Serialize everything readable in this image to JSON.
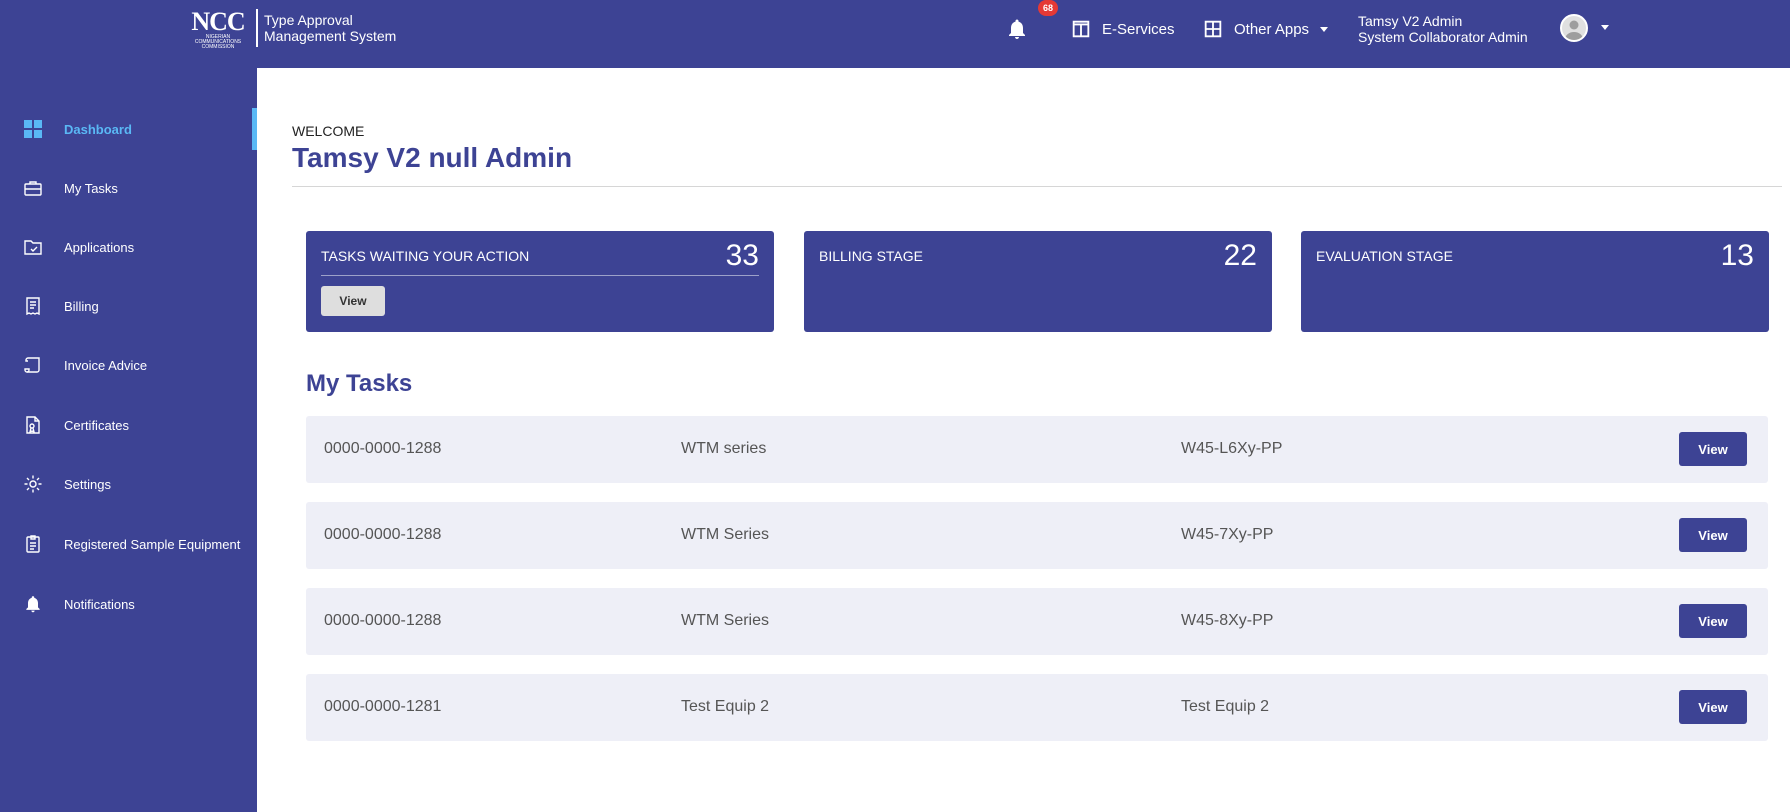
{
  "header": {
    "logo_text": "NCC",
    "logo_subtext": "NIGERIAN COMMUNICATIONS COMMISSION",
    "app_title_line1": "Type Approval",
    "app_title_line2": "Management System",
    "notification_count": "68",
    "eservices_label": "E-Services",
    "other_apps_label": "Other Apps",
    "user_name": "Tamsy V2 Admin",
    "user_role": "System Collaborator Admin"
  },
  "sidebar": {
    "items": [
      {
        "label": "Dashboard",
        "icon": "dashboard-icon",
        "active": true
      },
      {
        "label": "My Tasks",
        "icon": "briefcase-icon"
      },
      {
        "label": "Applications",
        "icon": "folder-check-icon"
      },
      {
        "label": "Billing",
        "icon": "receipt-icon"
      },
      {
        "label": "Invoice Advice",
        "icon": "scroll-icon"
      },
      {
        "label": "Certificates",
        "icon": "certificate-icon"
      },
      {
        "label": "Settings",
        "icon": "gear-icon"
      },
      {
        "label": "Registered Sample Equipment",
        "icon": "clipboard-icon"
      },
      {
        "label": "Notifications",
        "icon": "bell-icon"
      }
    ]
  },
  "main": {
    "welcome_label": "WELCOME",
    "user_display_name": "Tamsy V2 null Admin",
    "cards": [
      {
        "label": "TASKS WAITING YOUR ACTION",
        "count": "33",
        "button_label": "View"
      },
      {
        "label": "BILLING STAGE",
        "count": "22"
      },
      {
        "label": "EVALUATION STAGE",
        "count": "13"
      }
    ],
    "tasks_title": "My Tasks",
    "tasks": [
      {
        "id": "0000-0000-1288",
        "name": "WTM series",
        "model": "W45-L6Xy-PP",
        "button_label": "View"
      },
      {
        "id": "0000-0000-1288",
        "name": "WTM Series",
        "model": "W45-7Xy-PP",
        "button_label": "View"
      },
      {
        "id": "0000-0000-1288",
        "name": "WTM Series",
        "model": "W45-8Xy-PP",
        "button_label": "View"
      },
      {
        "id": "0000-0000-1281",
        "name": "Test Equip 2",
        "model": "Test Equip 2",
        "button_label": "View"
      }
    ]
  },
  "colors": {
    "brand": "#3d4394",
    "active": "#5ab8f5",
    "badge": "#e53935",
    "row_bg": "#eeeff7"
  }
}
